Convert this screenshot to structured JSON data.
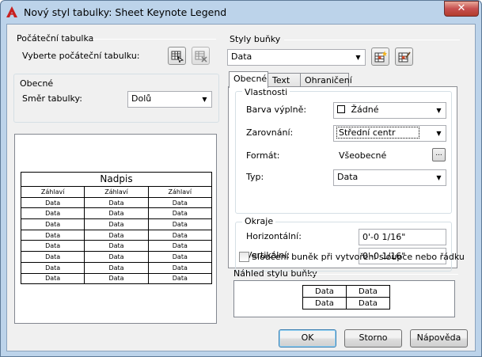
{
  "window": {
    "title": "Nový styl tabulky: Sheet Keynote Legend",
    "close_label": "✕"
  },
  "starting_table": {
    "group_title": "Počáteční tabulka",
    "select_label": "Vyberte počáteční tabulku:"
  },
  "general": {
    "group_title": "Obecné",
    "direction_label": "Směr tabulky:",
    "direction_value": "Dolů"
  },
  "preview_table": {
    "title": "Nadpis",
    "headers": [
      "Záhlaví",
      "Záhlaví",
      "Záhlaví"
    ],
    "rows": [
      [
        "Data",
        "Data",
        "Data"
      ],
      [
        "Data",
        "Data",
        "Data"
      ],
      [
        "Data",
        "Data",
        "Data"
      ],
      [
        "Data",
        "Data",
        "Data"
      ],
      [
        "Data",
        "Data",
        "Data"
      ],
      [
        "Data",
        "Data",
        "Data"
      ],
      [
        "Data",
        "Data",
        "Data"
      ],
      [
        "Data",
        "Data",
        "Data"
      ]
    ]
  },
  "cell_styles": {
    "group_title": "Styly buňky",
    "value": "Data"
  },
  "tabs": [
    {
      "label": "Obecné",
      "active": true
    },
    {
      "label": "Text",
      "active": false
    },
    {
      "label": "Ohraničení",
      "active": false
    }
  ],
  "properties": {
    "group_title": "Vlastnosti",
    "fill_color_label": "Barva výplně:",
    "fill_color_value": "Žádné",
    "alignment_label": "Zarovnání:",
    "alignment_value": "Střední centr",
    "format_label": "Formát:",
    "format_value": "Všeobecné",
    "format_button": "...",
    "type_label": "Typ:",
    "type_value": "Data"
  },
  "margins": {
    "group_title": "Okraje",
    "horizontal_label": "Horizontální:",
    "horizontal_value": "0'-0 1/16\"",
    "vertical_label": "Vertikální:",
    "vertical_value": "0'-0 1/16\""
  },
  "merge": {
    "label": "Sloučení buněk při vytvoření sloupce nebo řádku",
    "checked": false
  },
  "cell_style_preview": {
    "group_title": "Náhled stylu buňky",
    "cells": [
      [
        "Data",
        "Data"
      ],
      [
        "Data",
        "Data"
      ]
    ]
  },
  "buttons": {
    "ok": "OK",
    "cancel": "Storno",
    "help": "Nápověda"
  }
}
